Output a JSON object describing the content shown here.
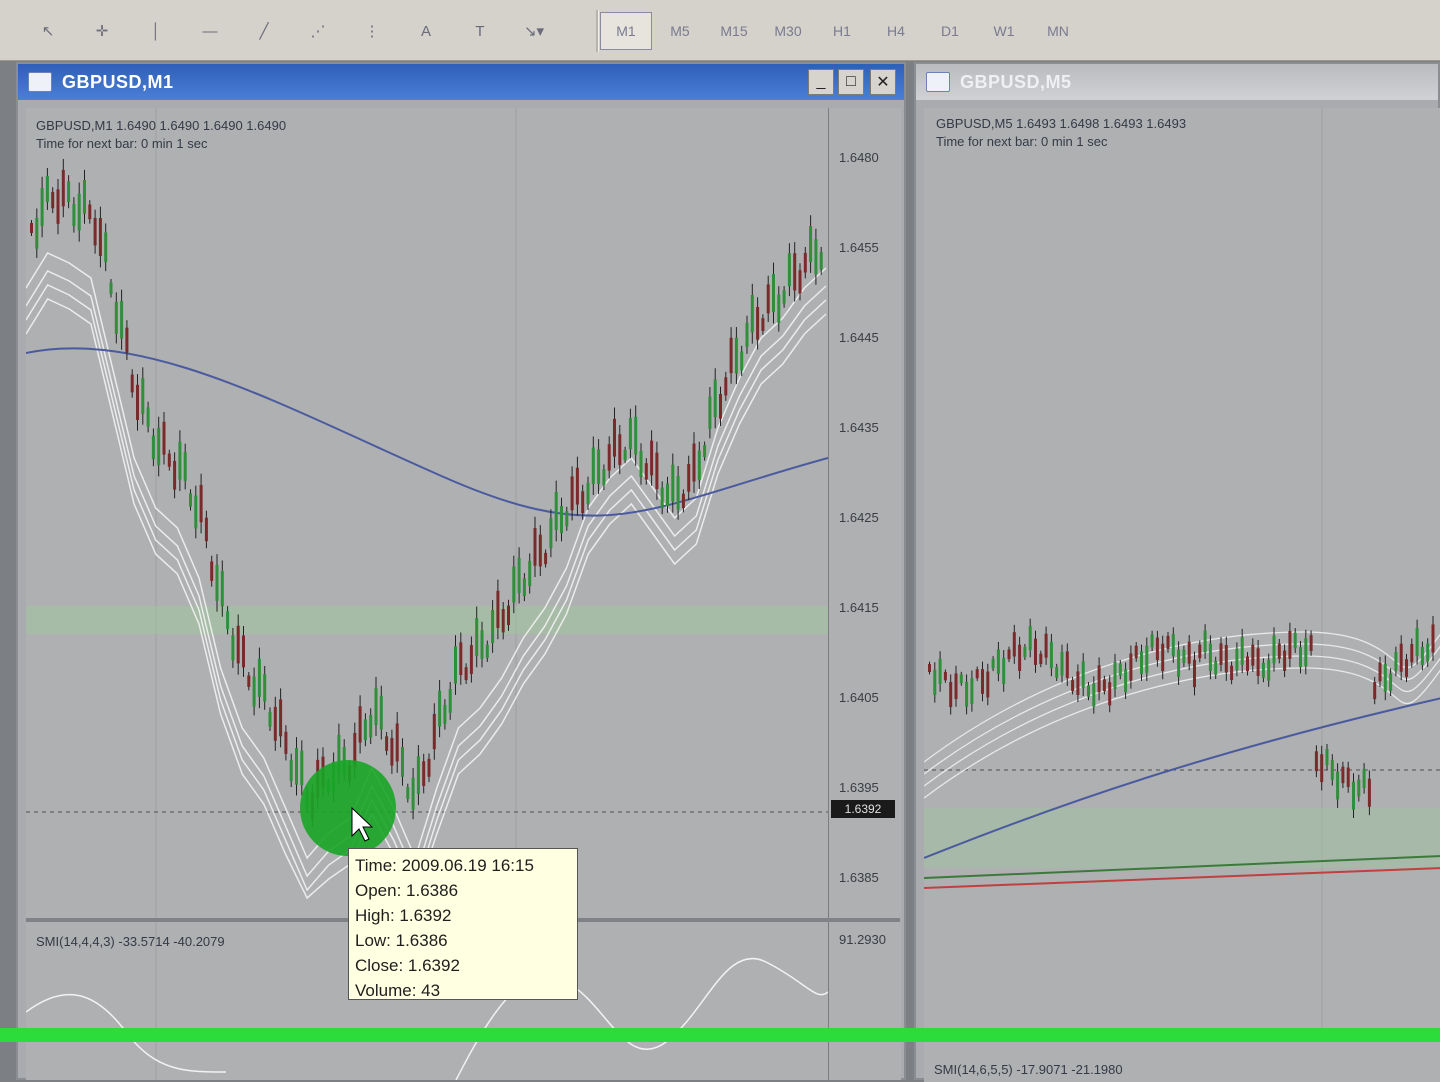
{
  "toolbar": {
    "tools": [
      {
        "name": "cursor-arrow-icon",
        "glyph": "↖"
      },
      {
        "name": "crosshair-icon",
        "glyph": "✛"
      },
      {
        "name": "vertical-line-icon",
        "glyph": "│"
      },
      {
        "name": "horizontal-line-icon",
        "glyph": "—"
      },
      {
        "name": "trendline-icon",
        "glyph": "╱"
      },
      {
        "name": "channel-icon",
        "glyph": "⋰"
      },
      {
        "name": "fibonacci-icon",
        "glyph": "⋮"
      },
      {
        "name": "text-icon",
        "glyph": "A"
      },
      {
        "name": "label-icon",
        "glyph": "T"
      },
      {
        "name": "arrow-shapes-icon",
        "glyph": "↘▾"
      }
    ],
    "timeframes": [
      "M1",
      "M5",
      "M15",
      "M30",
      "H1",
      "H4",
      "D1",
      "W1",
      "MN"
    ],
    "active_timeframe": "M1"
  },
  "left_window": {
    "title": "GBPUSD,M1",
    "buttons": {
      "minimize": "_",
      "maximize": "□",
      "close": "✕"
    },
    "info_line1": "GBPUSD,M1  1.6490 1.6490 1.6490 1.6490",
    "info_line2": "Time for next bar: 0 min 1 sec",
    "price_labels": [
      "1.6480",
      "1.6455",
      "1.6445",
      "1.6435",
      "1.6425",
      "1.6415",
      "1.6405",
      "1.6395",
      "1.6385"
    ],
    "current_price": "1.6392",
    "indicator_label": "SMI(14,4,4,3)  -33.5714  -40.2079",
    "indicator_value": "91.2930",
    "tooltip": {
      "time": "Time:  2009.06.19 16:15",
      "open": "Open:  1.6386",
      "high": "High:  1.6392",
      "low": "Low:    1.6386",
      "close": "Close:  1.6392",
      "volume": "Volume: 43"
    }
  },
  "right_window": {
    "title": "GBPUSD,M5",
    "info_line1": "GBPUSD,M5  1.6493 1.6498 1.6493 1.6493",
    "info_line2": "Time for next bar: 0 min 1 sec",
    "indicator_label": "SMI(14,6,5,5)  -17.9071  -21.1980"
  },
  "colors": {
    "active_title": "#2f5fb8",
    "bull_candle": "#2f8f3a",
    "bear_candle": "#7a2a2a",
    "envelope": "#f2f2f2",
    "ma_line": "#4b5a9e",
    "highlight": "#2cdc3a"
  }
}
